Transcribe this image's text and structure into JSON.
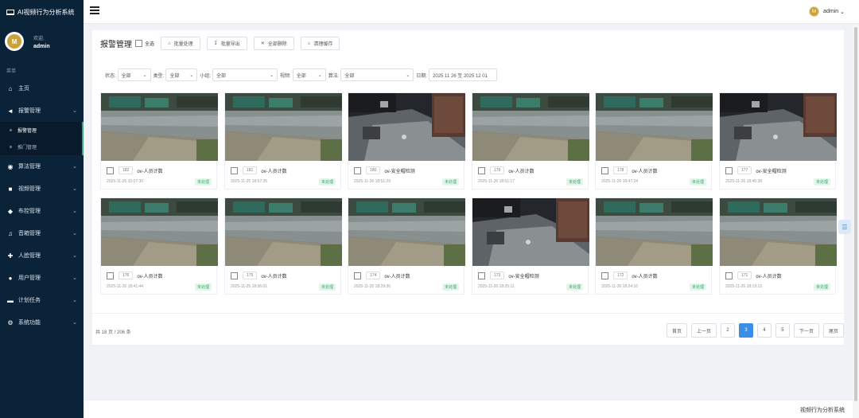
{
  "app": {
    "title": "AI视频行为分析系统"
  },
  "user": {
    "welcome": "欢迎,",
    "name": "admin",
    "topbar_name": "admin"
  },
  "sidebar": {
    "menu_title": "菜单",
    "items": [
      {
        "label": "主页",
        "icon": "home-icon"
      },
      {
        "label": "报警管理",
        "icon": "megaphone-icon"
      },
      {
        "label": "算法管理",
        "icon": "eye-icon"
      },
      {
        "label": "视频管理",
        "icon": "video-icon"
      },
      {
        "label": "布控管理",
        "icon": "shield-icon"
      },
      {
        "label": "音箱管理",
        "icon": "music-icon"
      },
      {
        "label": "人脸管理",
        "icon": "user-plus-icon"
      },
      {
        "label": "用户管理",
        "icon": "user-icon"
      },
      {
        "label": "计划任务",
        "icon": "folder-icon"
      },
      {
        "label": "系统功能",
        "icon": "gear-icon"
      }
    ],
    "subitems": [
      {
        "label": "报警管理"
      },
      {
        "label": "推门管理"
      }
    ]
  },
  "panel": {
    "title": "报警管理",
    "select_all": "全选",
    "buttons": {
      "batch_process": "批量处理",
      "batch_export": "批量导出",
      "delete_all": "全部删除",
      "clear_cache": "清理缓存"
    }
  },
  "filters": {
    "status_label": "状态:",
    "status_value": "全部",
    "type_label": "类型:",
    "type_value": "全部",
    "algo_label": "小组:",
    "algo_value": "全部",
    "video_label": "视频:",
    "video_value": "全部",
    "camera_label": "算法:",
    "camera_value": "全部",
    "date_label": "日期:",
    "date_value": "2025 11 26 至 2025 12 01"
  },
  "alarms": [
    {
      "id": "182",
      "name": "ov-人员计数",
      "time": "2025-11-26 10:07:30",
      "status": "未处理",
      "scene": "day"
    },
    {
      "id": "181",
      "name": "ov-人员计数",
      "time": "2025-11-25 18:57:35",
      "status": "未处理",
      "scene": "day"
    },
    {
      "id": "180",
      "name": "ov-安全帽检测",
      "time": "2025-11-26 18:51:29",
      "status": "未处理",
      "scene": "night"
    },
    {
      "id": "179",
      "name": "ov-人员计数",
      "time": "2025-11-26 18:51:17",
      "status": "未处理",
      "scene": "day"
    },
    {
      "id": "178",
      "name": "ov-人员计数",
      "time": "2025-11-26 18:47:24",
      "status": "未处理",
      "scene": "day"
    },
    {
      "id": "177",
      "name": "ov-安全帽检测",
      "time": "2025-11-26 18:45:38",
      "status": "未处理",
      "scene": "night"
    },
    {
      "id": "176",
      "name": "ov-人员计数",
      "time": "2025-11-26 18:41:44",
      "status": "未处理",
      "scene": "day"
    },
    {
      "id": "175",
      "name": "ov-人员计数",
      "time": "2025-11-25 18:36:01",
      "status": "未处理",
      "scene": "day"
    },
    {
      "id": "174",
      "name": "ov-人员计数",
      "time": "2025-11-26 18:29:36",
      "status": "未处理",
      "scene": "day"
    },
    {
      "id": "173",
      "name": "ov-安全帽检测",
      "time": "2025-11-26 18:25:11",
      "status": "未处理",
      "scene": "night"
    },
    {
      "id": "172",
      "name": "ov-人员计数",
      "time": "2025-11-26 18:24:16",
      "status": "未处理",
      "scene": "day"
    },
    {
      "id": "171",
      "name": "ov-人员计数",
      "time": "2025-11-26 18:19:13",
      "status": "未处理",
      "scene": "day"
    }
  ],
  "pagination": {
    "total_text": "共 18 页 / 206 条",
    "first": "首页",
    "prev": "上一页",
    "pages": [
      "2",
      "3",
      "4",
      "5"
    ],
    "current": "3",
    "next": "下一页",
    "last": "尾页"
  },
  "footer": {
    "text": "视频行为分析系统"
  }
}
